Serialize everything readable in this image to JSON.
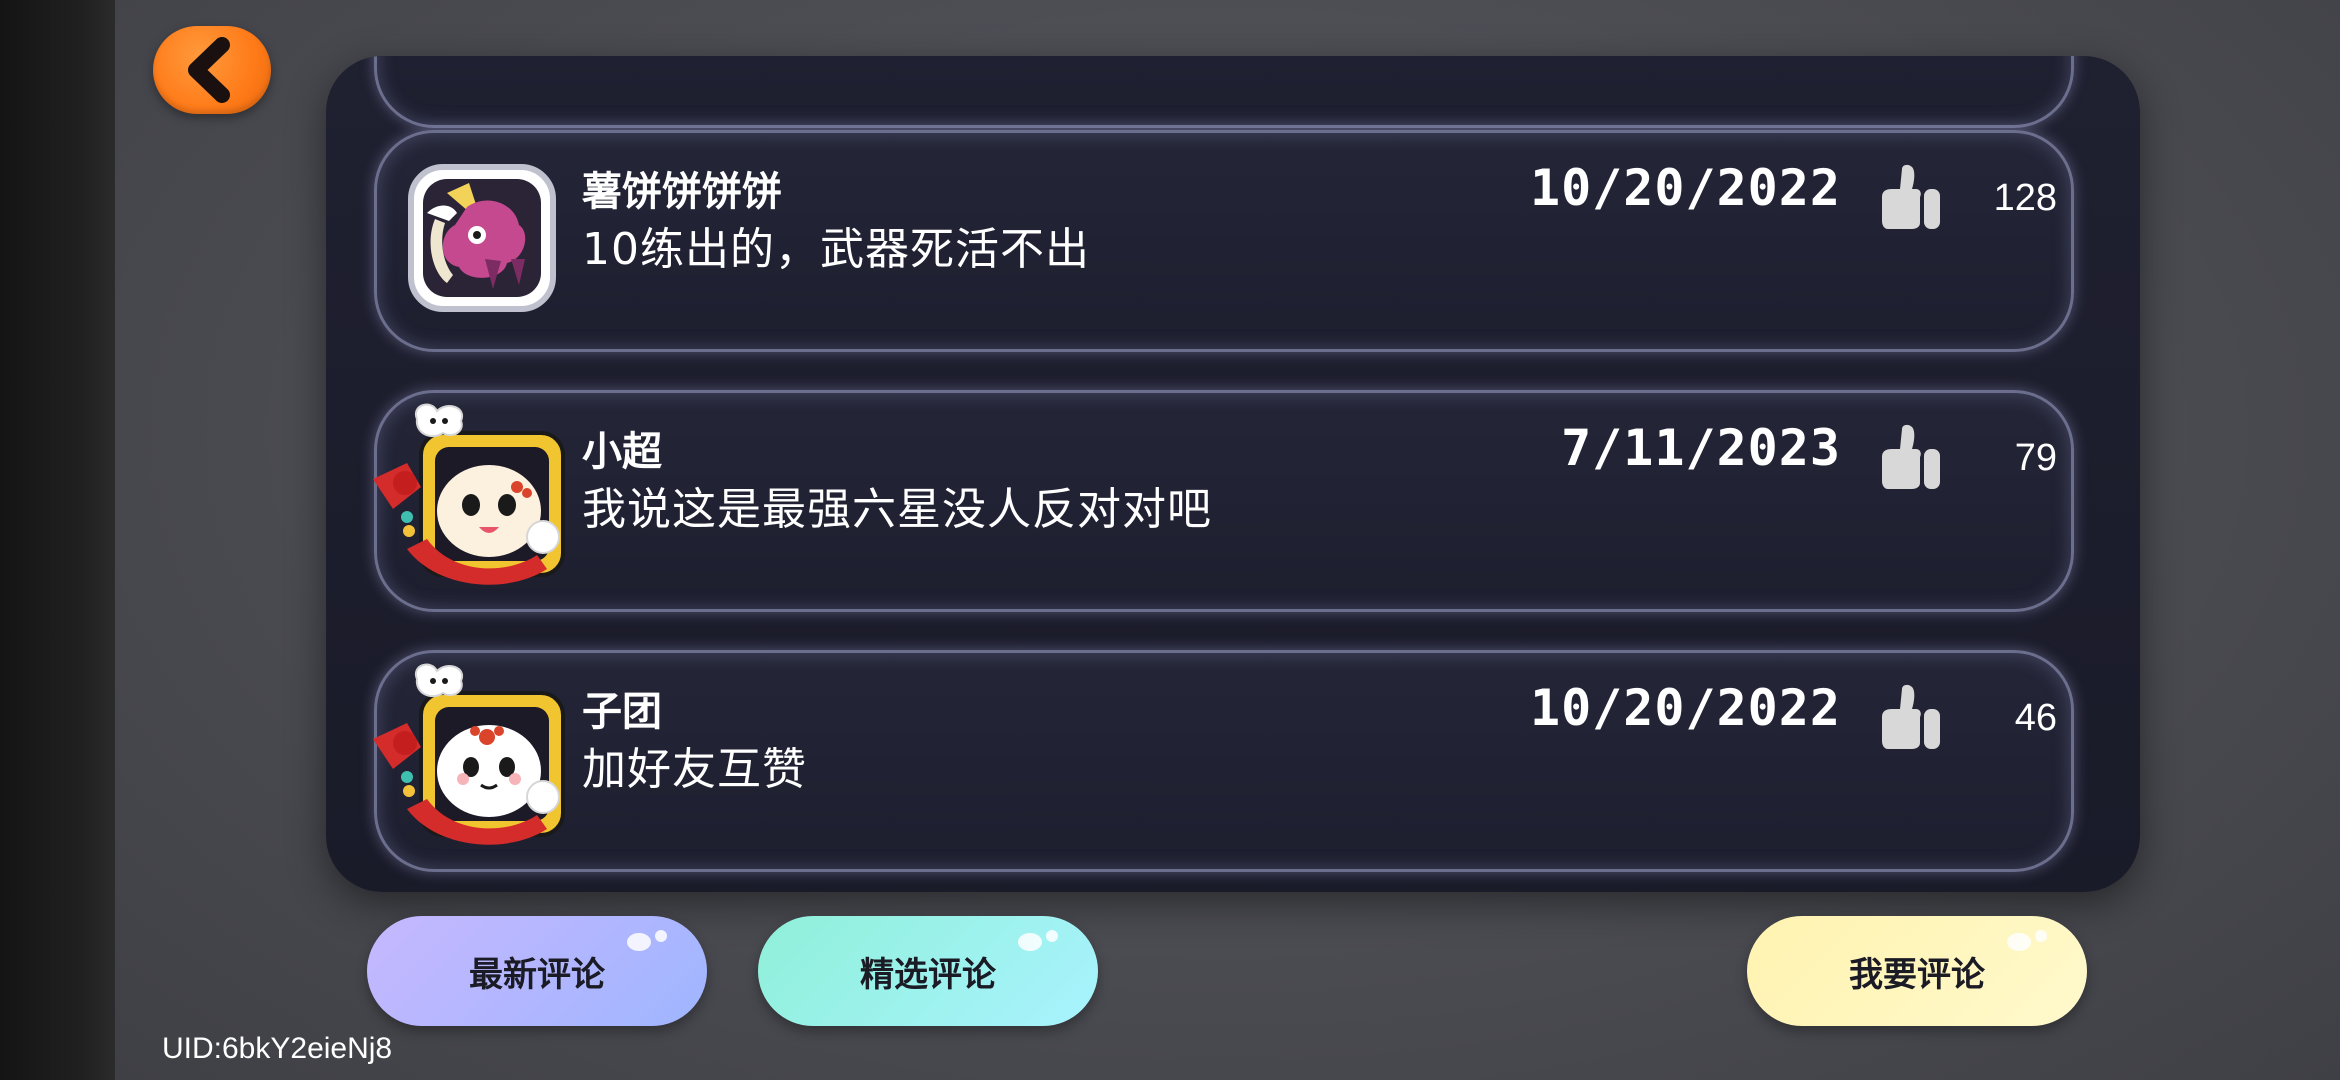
{
  "comments": [
    {
      "user": "薯饼饼饼饼",
      "text": "10练出的，武器死活不出",
      "date": "10/20/2022",
      "likes": "128"
    },
    {
      "user": "小超",
      "text": "我说这是最强六星没人反对对吧",
      "date": "7/11/2023",
      "likes": "79"
    },
    {
      "user": "子团",
      "text": "加好友互赞",
      "date": "10/20/2022",
      "likes": "46"
    }
  ],
  "buttons": {
    "latest": "最新评论",
    "featured": "精选评论",
    "write": "我要评论"
  },
  "uid": "UID:6bkY2eieNj8",
  "colors": {
    "back_button": "#ff7a18",
    "latest_button": "#b3b8ff",
    "featured_button": "#99f0e6",
    "write_button": "#fff5bb",
    "panel": "#1d1e2d"
  },
  "icons": {
    "back": "chevron-left-icon",
    "like": "thumbs-up-icon"
  }
}
